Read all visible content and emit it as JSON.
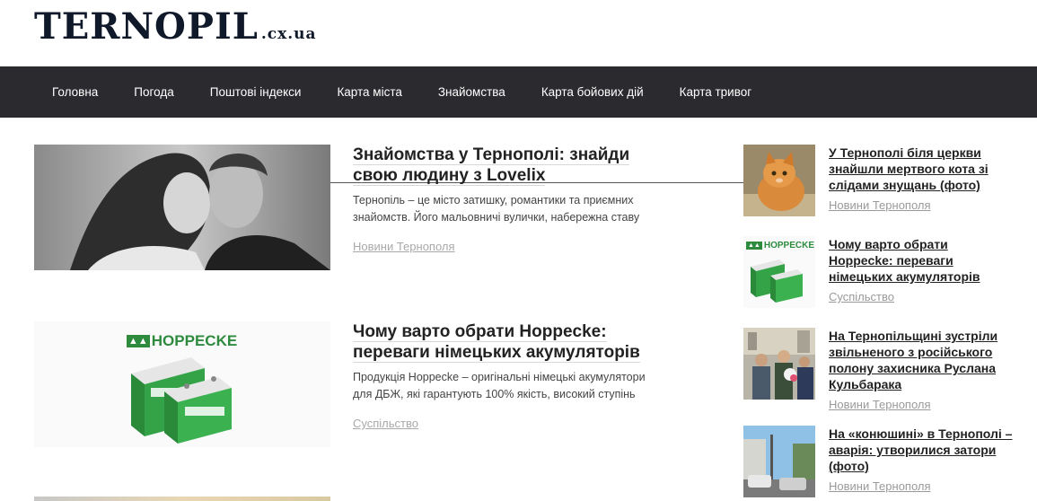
{
  "site": {
    "logo_main": "TERNOPIL",
    "logo_sub": ".cx.ua"
  },
  "nav": {
    "items": [
      {
        "label": "Головна"
      },
      {
        "label": "Погода"
      },
      {
        "label": "Поштові індекси"
      },
      {
        "label": "Карта міста"
      },
      {
        "label": "Знайомства"
      },
      {
        "label": "Карта бойових дій"
      },
      {
        "label": "Карта тривог"
      }
    ]
  },
  "articles": [
    {
      "title": "Знайомства у Тернополі: знайди свою людину з Lovelix",
      "excerpt": "Тернопіль – це місто затишку, романтики та приємних знайомств. Його мальовничі вулички, набережна ставу",
      "category": "Новини Тернополя",
      "image_icon": "couple-photo"
    },
    {
      "title": "Чому варто обрати Hoppecke: переваги німецьких акумуляторів",
      "excerpt": "Продукція Hoppecke – оригінальні німецькі акумулятори для ДБЖ, які гарантують 100% якість, високий ступінь",
      "category": "Суспільство",
      "image_logo": "HOPPECKE"
    }
  ],
  "sidebar": {
    "items": [
      {
        "title": "У Тернополі біля церкви знайшли мертвого кота зі слідами знущань (фото)",
        "category": "Новини Тернополя",
        "image_icon": "cat-photo"
      },
      {
        "title": "Чому варто обрати Hoppecke: переваги німецьких акумуляторів",
        "category": "Суспільство",
        "image_logo": "HOPPECKE"
      },
      {
        "title": "На Тернопільщині зустріли звільненого з російського полону захисника Руслана Кульбарака",
        "category": "Новини Тернополя",
        "image_icon": "crowd-photo"
      },
      {
        "title": "На «конюшині» в Тернополі – аварія: утворилися затори (фото)",
        "category": "Новини Тернополя",
        "image_icon": "street-photo"
      }
    ]
  }
}
